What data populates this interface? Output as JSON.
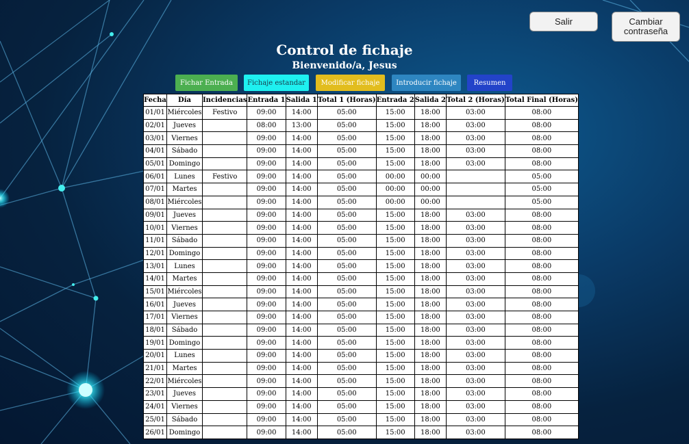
{
  "header": {
    "logout_label": "Salir",
    "change_password_label": "Cambiar\ncontraseña",
    "title": "Control de fichaje",
    "welcome": "Bienvenido/a, Jesus"
  },
  "actions": {
    "fichar_entrada": "Fichar Entrada",
    "fichaje_estandar": "Fichaje estandar",
    "modificar_fichaje": "Modificar fichaje",
    "introducir_fichaje": "Introducir fichaje",
    "resumen": "Resumen"
  },
  "colors": {
    "fichar_entrada": "#4caf50",
    "fichaje_estandar": "#1ef0f0",
    "modificar_fichaje": "#e2bd1e",
    "introducir_fichaje": "#2e86c1",
    "resumen": "#2343c9"
  },
  "table": {
    "columns": [
      "Fecha",
      "Día",
      "Incidencias",
      "Entrada 1",
      "Salida 1",
      "Total 1 (Horas)",
      "Entrada 2",
      "Salida 2",
      "Total 2 (Horas)",
      "Total Final (Horas)"
    ],
    "rows": [
      [
        "01/01",
        "Miércoles",
        "Festivo",
        "09:00",
        "14:00",
        "05:00",
        "15:00",
        "18:00",
        "03:00",
        "08:00"
      ],
      [
        "02/01",
        "Jueves",
        "",
        "08:00",
        "13:00",
        "05:00",
        "15:00",
        "18:00",
        "03:00",
        "08:00"
      ],
      [
        "03/01",
        "Viernes",
        "",
        "09:00",
        "14:00",
        "05:00",
        "15:00",
        "18:00",
        "03:00",
        "08:00"
      ],
      [
        "04/01",
        "Sábado",
        "",
        "09:00",
        "14:00",
        "05:00",
        "15:00",
        "18:00",
        "03:00",
        "08:00"
      ],
      [
        "05/01",
        "Domingo",
        "",
        "09:00",
        "14:00",
        "05:00",
        "15:00",
        "18:00",
        "03:00",
        "08:00"
      ],
      [
        "06/01",
        "Lunes",
        "Festivo",
        "09:00",
        "14:00",
        "05:00",
        "00:00",
        "00:00",
        "",
        "05:00"
      ],
      [
        "07/01",
        "Martes",
        "",
        "09:00",
        "14:00",
        "05:00",
        "00:00",
        "00:00",
        "",
        "05:00"
      ],
      [
        "08/01",
        "Miércoles",
        "",
        "09:00",
        "14:00",
        "05:00",
        "00:00",
        "00:00",
        "",
        "05:00"
      ],
      [
        "09/01",
        "Jueves",
        "",
        "09:00",
        "14:00",
        "05:00",
        "15:00",
        "18:00",
        "03:00",
        "08:00"
      ],
      [
        "10/01",
        "Viernes",
        "",
        "09:00",
        "14:00",
        "05:00",
        "15:00",
        "18:00",
        "03:00",
        "08:00"
      ],
      [
        "11/01",
        "Sábado",
        "",
        "09:00",
        "14:00",
        "05:00",
        "15:00",
        "18:00",
        "03:00",
        "08:00"
      ],
      [
        "12/01",
        "Domingo",
        "",
        "09:00",
        "14:00",
        "05:00",
        "15:00",
        "18:00",
        "03:00",
        "08:00"
      ],
      [
        "13/01",
        "Lunes",
        "",
        "09:00",
        "14:00",
        "05:00",
        "15:00",
        "18:00",
        "03:00",
        "08:00"
      ],
      [
        "14/01",
        "Martes",
        "",
        "09:00",
        "14:00",
        "05:00",
        "15:00",
        "18:00",
        "03:00",
        "08:00"
      ],
      [
        "15/01",
        "Miércoles",
        "",
        "09:00",
        "14:00",
        "05:00",
        "15:00",
        "18:00",
        "03:00",
        "08:00"
      ],
      [
        "16/01",
        "Jueves",
        "",
        "09:00",
        "14:00",
        "05:00",
        "15:00",
        "18:00",
        "03:00",
        "08:00"
      ],
      [
        "17/01",
        "Viernes",
        "",
        "09:00",
        "14:00",
        "05:00",
        "15:00",
        "18:00",
        "03:00",
        "08:00"
      ],
      [
        "18/01",
        "Sábado",
        "",
        "09:00",
        "14:00",
        "05:00",
        "15:00",
        "18:00",
        "03:00",
        "08:00"
      ],
      [
        "19/01",
        "Domingo",
        "",
        "09:00",
        "14:00",
        "05:00",
        "15:00",
        "18:00",
        "03:00",
        "08:00"
      ],
      [
        "20/01",
        "Lunes",
        "",
        "09:00",
        "14:00",
        "05:00",
        "15:00",
        "18:00",
        "03:00",
        "08:00"
      ],
      [
        "21/01",
        "Martes",
        "",
        "09:00",
        "14:00",
        "05:00",
        "15:00",
        "18:00",
        "03:00",
        "08:00"
      ],
      [
        "22/01",
        "Miércoles",
        "",
        "09:00",
        "14:00",
        "05:00",
        "15:00",
        "18:00",
        "03:00",
        "08:00"
      ],
      [
        "23/01",
        "Jueves",
        "",
        "09:00",
        "14:00",
        "05:00",
        "15:00",
        "18:00",
        "03:00",
        "08:00"
      ],
      [
        "24/01",
        "Viernes",
        "",
        "09:00",
        "14:00",
        "05:00",
        "15:00",
        "18:00",
        "03:00",
        "08:00"
      ],
      [
        "25/01",
        "Sábado",
        "",
        "09:00",
        "14:00",
        "05:00",
        "15:00",
        "18:00",
        "03:00",
        "08:00"
      ],
      [
        "26/01",
        "Domingo",
        "",
        "09:00",
        "14:00",
        "05:00",
        "15:00",
        "18:00",
        "03:00",
        "08:00"
      ]
    ]
  }
}
